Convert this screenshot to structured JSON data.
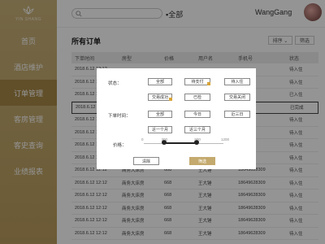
{
  "sidebar": {
    "logo_text": "YIN SHANG",
    "items": [
      {
        "label": "首页"
      },
      {
        "label": "酒店维护"
      },
      {
        "label": "订单管理"
      },
      {
        "label": "客房管理"
      },
      {
        "label": "客史查询"
      },
      {
        "label": "业绩报表"
      }
    ],
    "active_index": 2
  },
  "header": {
    "search_placeholder": "",
    "search_scope": "▪全部",
    "username": "WangGang"
  },
  "main": {
    "title": "所有订单",
    "sort_label": "排序 ⌄",
    "filter_label": "筛选",
    "columns": [
      "下单时间",
      "房型",
      "价格",
      "用户名",
      "手机号",
      "状态"
    ],
    "rows": [
      [
        "2018.6.12 12:12",
        "",
        "",
        "",
        "",
        "待入住"
      ],
      [
        "2018.6.12 12:12",
        "",
        "",
        "",
        "",
        "待入住"
      ],
      [
        "2018.6.12 12:12",
        "",
        "",
        "",
        "",
        "已入住"
      ],
      [
        "2018.6.12 12:12",
        "",
        "",
        "",
        "",
        "已完成"
      ],
      [
        "2018.6.12 12:12",
        "",
        "",
        "",
        "",
        "待入住"
      ],
      [
        "2018.6.12 12:12",
        "",
        "",
        "",
        "",
        "待入住"
      ],
      [
        "2018.6.12 12:12",
        "",
        "",
        "",
        "",
        "待入住"
      ],
      [
        "2018.6.12 12:12",
        "",
        "",
        "",
        "",
        "待入住"
      ],
      [
        "2018.6.12 12:12",
        "商务大床房",
        "668",
        "王大锤",
        "18649628309",
        "待入住"
      ],
      [
        "2018.6.12 12:12",
        "商务大床房",
        "668",
        "王大锤",
        "18649628309",
        "待入住"
      ],
      [
        "2018.6.12 12:12",
        "商务大床房",
        "668",
        "王大锤",
        "18649628309",
        "待入住"
      ],
      [
        "2018.6.12 12:12",
        "商务大床房",
        "668",
        "王大锤",
        "18649628309",
        "待入住"
      ],
      [
        "2018.6.12 12:12",
        "商务大床房",
        "668",
        "王大锤",
        "18649628309",
        "待入住"
      ],
      [
        "2018.6.12 12:12",
        "商务大床房",
        "668",
        "王大锤",
        "18649628309",
        "待入住"
      ]
    ],
    "highlight_row": 3
  },
  "modal": {
    "status_label": "状态：",
    "status_options": [
      "全部",
      "待支付",
      "待入住",
      "交易成功",
      "已检",
      "交易关闭"
    ],
    "status_selected": [
      1,
      3
    ],
    "time_label": "下单时间：",
    "time_options": [
      "全部",
      "今日",
      "近三日",
      "近一个月",
      "近三个月"
    ],
    "price_label": "价格：",
    "price_ticks": [
      "0",
      "300",
      "800",
      "1200"
    ],
    "price_range": [
      300,
      800
    ],
    "price_max": 1200,
    "clear_label": "清除",
    "confirm_label": "筛选"
  },
  "colors": {
    "sidebar": "#c4aa6e",
    "accent": "#c4aa6e",
    "selected_marker": "#d7a43a"
  }
}
